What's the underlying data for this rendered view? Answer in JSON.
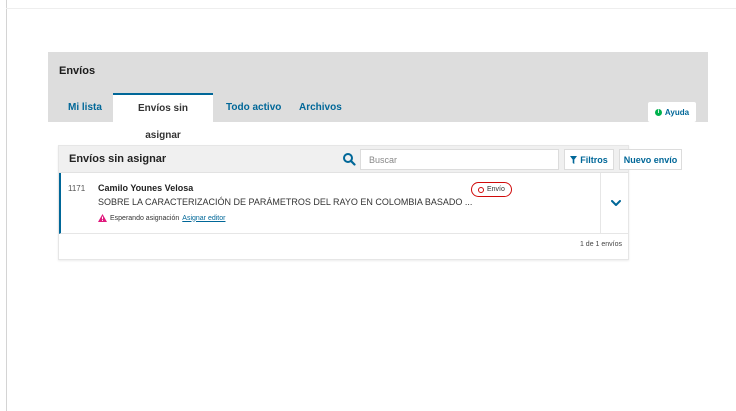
{
  "section": {
    "title": "Envíos"
  },
  "tabs": [
    {
      "label": "Mi lista"
    },
    {
      "label": "Envíos sin asignar"
    },
    {
      "label": "Todo activo"
    },
    {
      "label": "Archivos"
    }
  ],
  "help": {
    "label": "Ayuda"
  },
  "panel": {
    "title": "Envíos sin asignar",
    "search_placeholder": "Buscar",
    "filters_label": "Filtros",
    "new_label": "Nuevo envío"
  },
  "submission": {
    "id": "1171",
    "author": "Camilo Younes Velosa",
    "title": "SOBRE LA CARACTERIZACIÓN DE PARÁMETROS DEL RAYO EN COLOMBIA BASADO ...",
    "stage": "Envío",
    "status": "Esperando asignación",
    "assign_label": "Asignar editor"
  },
  "pagination": {
    "label": "1 de 1 envíos"
  },
  "colors": {
    "accent": "#006798",
    "stage": "#d00a0a",
    "warning": "#e0197d",
    "help": "#00b24e"
  }
}
